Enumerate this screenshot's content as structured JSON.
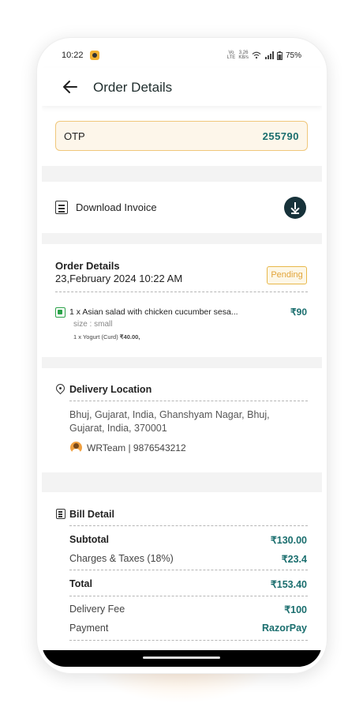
{
  "status_bar": {
    "time": "10:22",
    "net_top": "Vo",
    "net_bottom": "LTE",
    "speed_top": "3.26",
    "speed_bottom": "KB/s",
    "battery": "75%"
  },
  "header": {
    "title": "Order Details",
    "back_icon": "arrow-left-icon"
  },
  "otp": {
    "label": "OTP",
    "value": "255790"
  },
  "invoice": {
    "label": "Download Invoice",
    "icon": "invoice-icon",
    "button_icon": "download-icon"
  },
  "order": {
    "title": "Order Details",
    "date": "23,February 2024 10:22 AM",
    "status": "Pending",
    "status_color": "#e2a53a",
    "items": [
      {
        "name": "1 x Asian salad with chicken cucumber sesa...",
        "price": "₹90",
        "size": "size : small",
        "addon_name": "1 x Yogurt (Curd) ",
        "addon_price": "₹40.00,"
      }
    ]
  },
  "delivery": {
    "title": "Delivery Location",
    "address": "Bhuj, Gujarat, India, Ghanshyam Nagar, Bhuj, Gujarat, India, 370001",
    "contact": "WRTeam | 9876543212"
  },
  "bill": {
    "title": "Bill Detail",
    "subtotal_label": "Subtotal",
    "subtotal_value": "₹130.00",
    "charges_label": "Charges & Taxes (18%)",
    "charges_value": "₹23.4",
    "total_label": "Total",
    "total_value": "₹153.40",
    "delivery_label": "Delivery Fee",
    "delivery_value": "₹100",
    "payment_label": "Payment",
    "payment_value": "RazorPay"
  },
  "colors": {
    "accent": "#1a6e6e",
    "otp_border": "#f0c77b",
    "dark_button": "#17323a"
  }
}
